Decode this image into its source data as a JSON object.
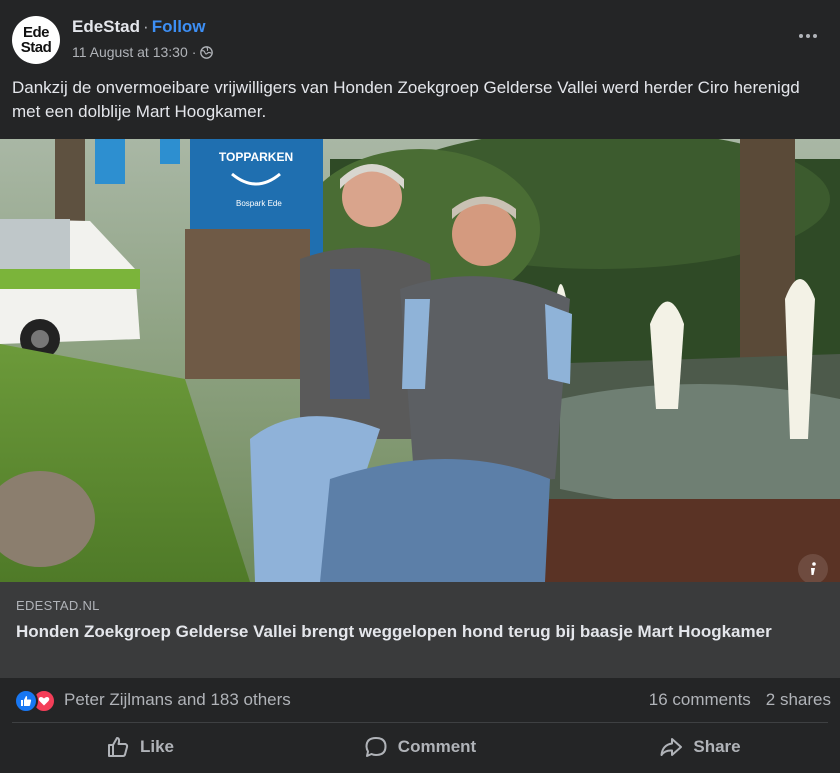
{
  "header": {
    "page_name": "EdeStad",
    "separator": "·",
    "follow_label": "Follow",
    "timestamp": "11 August at 13:30",
    "meta_separator": "·",
    "avatar_line1": "Ede",
    "avatar_line2": "Stad",
    "privacy_icon": "globe-icon",
    "more_icon": "more-options-icon"
  },
  "post": {
    "text": "Dankzij de onvermoeibare vrijwilligers van Honden Zoekgroep Gelderse Vallei werd herder Ciro herenigd met een dolblije Mart Hoogkamer."
  },
  "photo": {
    "sign_line1": "TOPPARKEN",
    "sign_line2": "Bospark Ede",
    "info_icon": "info-icon"
  },
  "link": {
    "domain": "EDESTAD.NL",
    "title": "Honden Zoekgroep Gelderse Vallei brengt weggelopen hond terug bij baasje Mart Hoogkamer"
  },
  "reactions": {
    "icons": [
      "like-reaction-icon",
      "love-reaction-icon"
    ],
    "names": "Peter Zijlmans and 183 others",
    "comments": "16 comments",
    "shares": "2 shares"
  },
  "actions": [
    {
      "label": "Like",
      "icon": "thumbs-up-icon"
    },
    {
      "label": "Comment",
      "icon": "comment-icon"
    },
    {
      "label": "Share",
      "icon": "share-icon"
    }
  ],
  "colors": {
    "background": "#242526",
    "link_box": "#3a3b3c",
    "accent": "#3d8ff5",
    "like": "#1877f2",
    "love": "#f33e58"
  }
}
